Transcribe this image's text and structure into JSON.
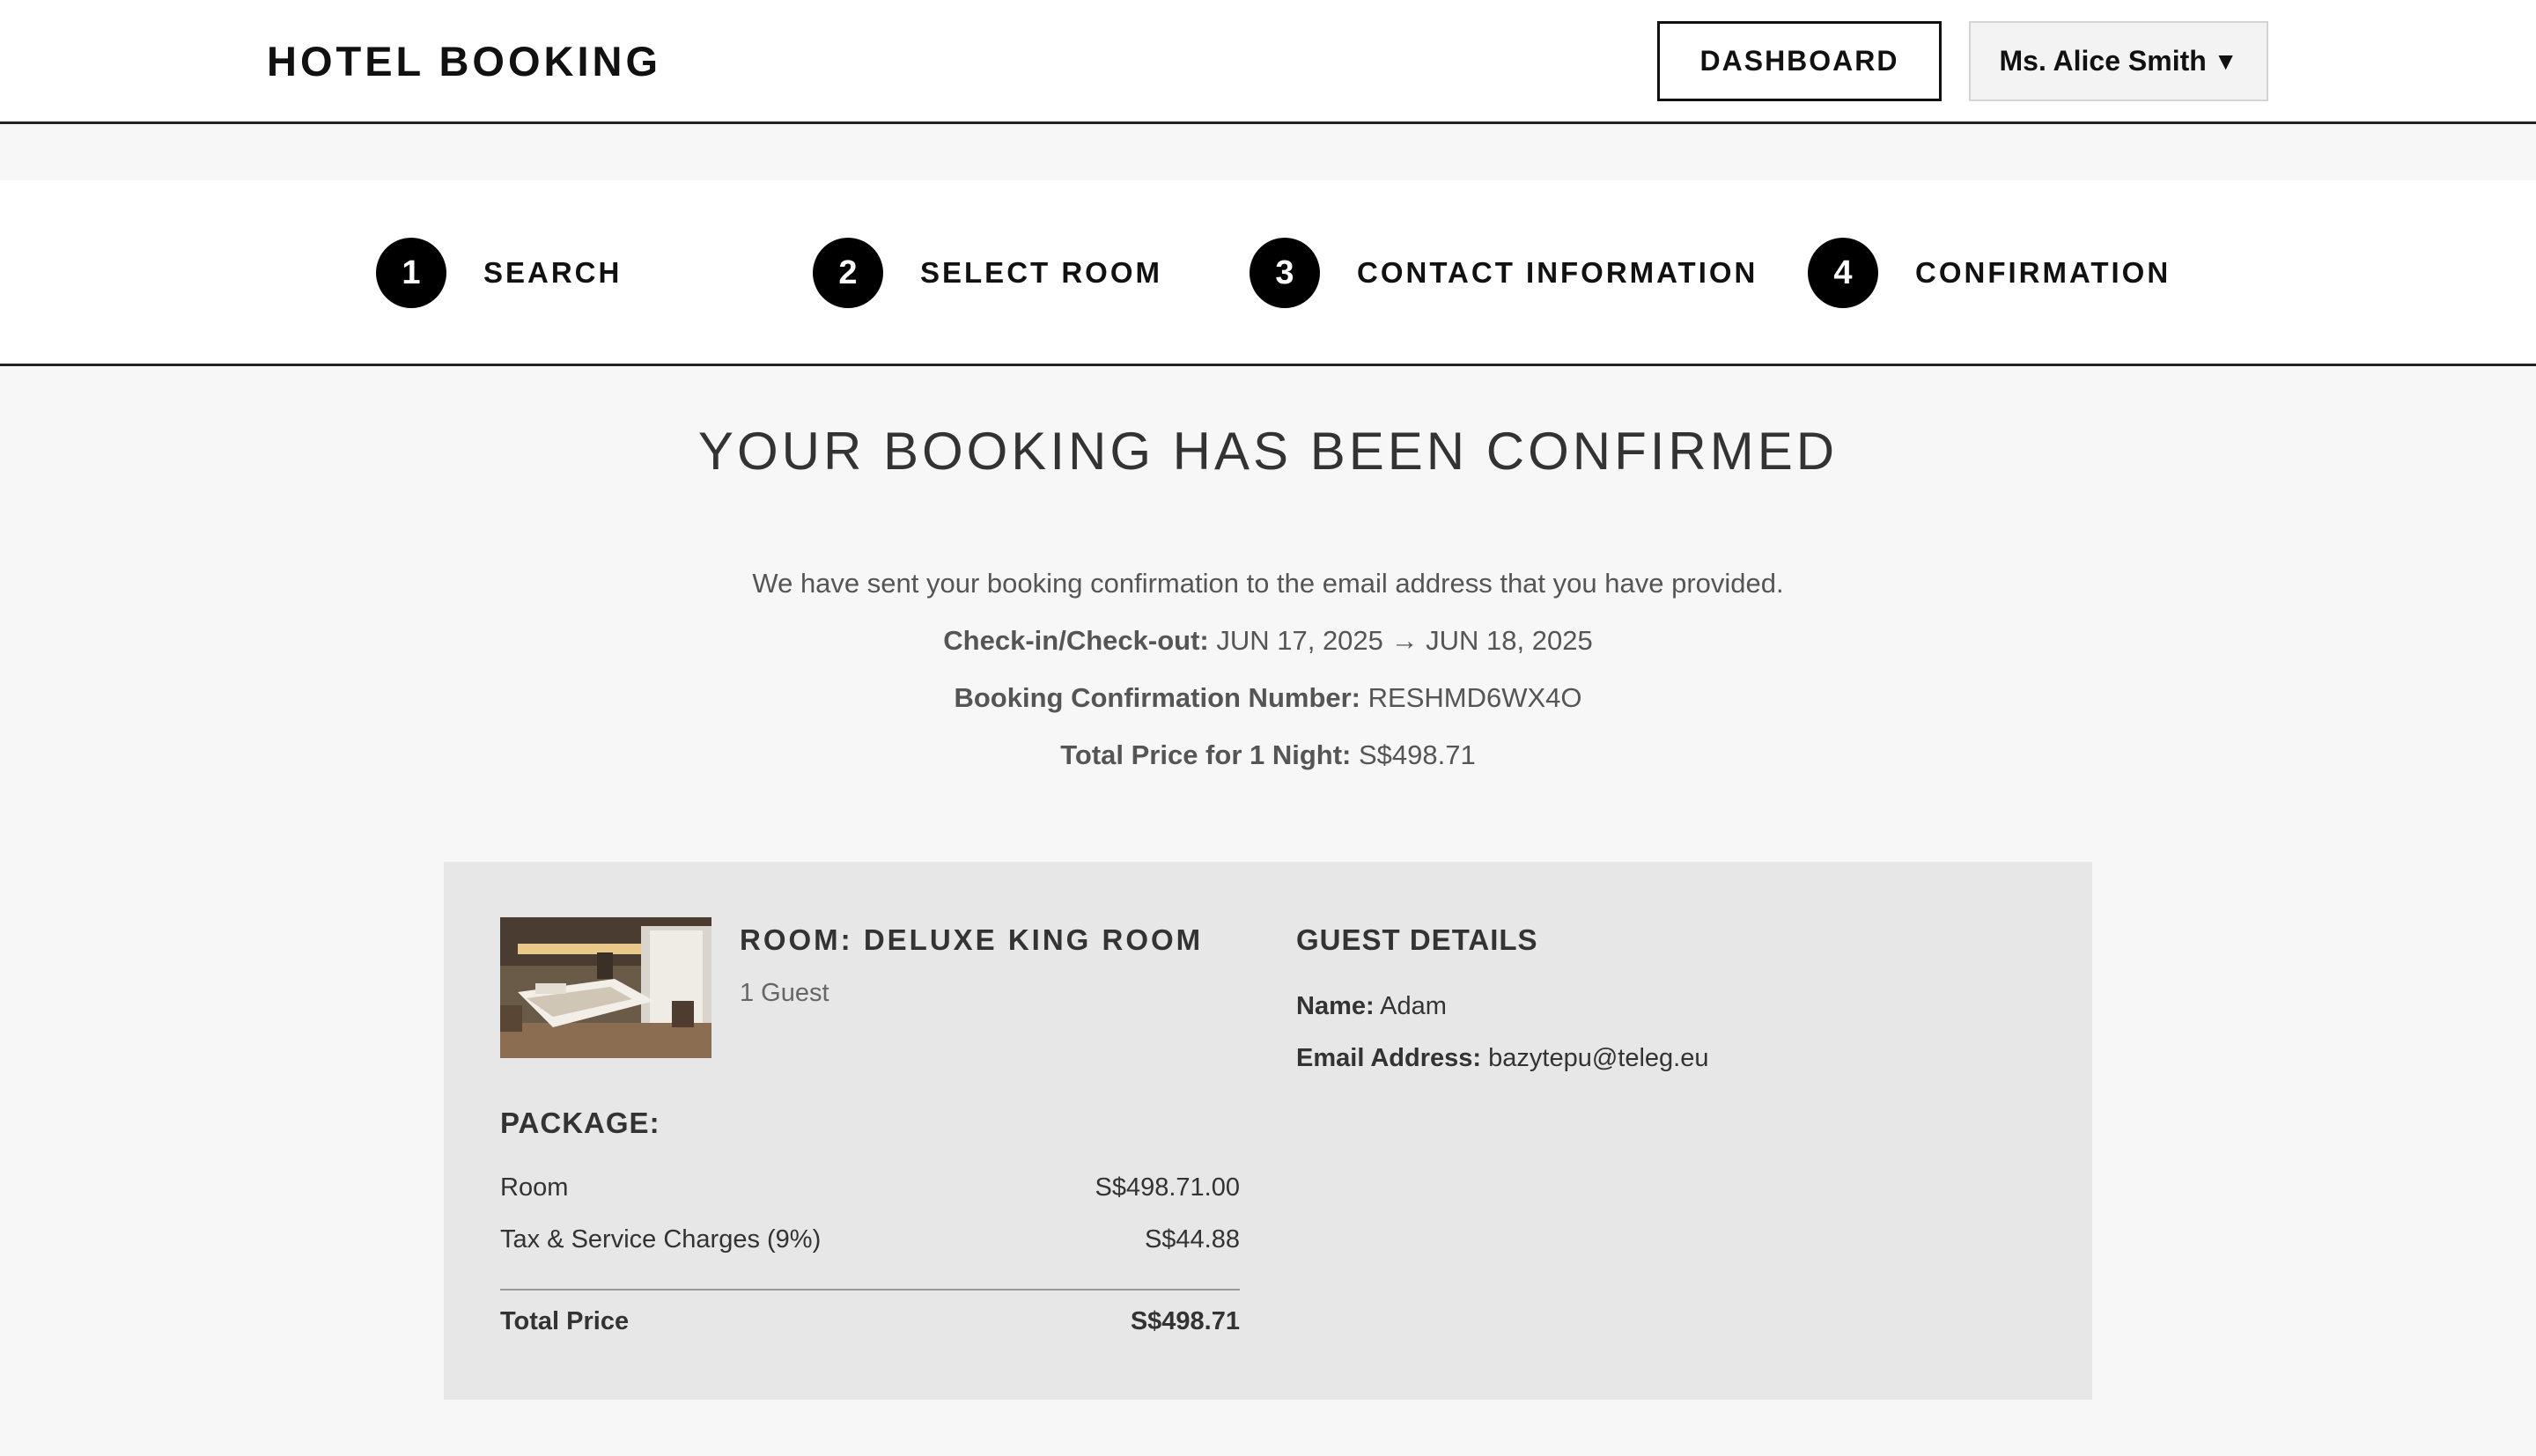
{
  "header": {
    "brand": "HOTEL BOOKING",
    "dashboard_label": "DASHBOARD",
    "user_label": "Ms. Alice Smith",
    "user_caret": "▼"
  },
  "steps": [
    {
      "number": "1",
      "label": "SEARCH"
    },
    {
      "number": "2",
      "label": "SELECT ROOM"
    },
    {
      "number": "3",
      "label": "CONTACT INFORMATION"
    },
    {
      "number": "4",
      "label": "CONFIRMATION"
    }
  ],
  "confirmation": {
    "title": "YOUR BOOKING HAS BEEN CONFIRMED",
    "message": "We have sent your booking confirmation to the email address that you have provided.",
    "checkin_label": "Check-in/Check-out:",
    "checkin_value": "JUN 17, 2025 → JUN 18, 2025",
    "number_label": "Booking Confirmation Number:",
    "number_value": "RESHMD6WX4O",
    "total_label": "Total Price for 1 Night:",
    "total_value": "S$498.71"
  },
  "room": {
    "title": "ROOM: DELUXE KING ROOM",
    "guests": "1 Guest"
  },
  "guest": {
    "heading": "GUEST DETAILS",
    "name_label": "Name:",
    "name_value": "Adam",
    "email_label": "Email Address:",
    "email_value": "bazytepu@teleg.eu"
  },
  "package": {
    "heading": "PACKAGE:",
    "rows": [
      {
        "label": "Room",
        "value": "S$498.71.00"
      },
      {
        "label": "Tax & Service Charges (9%)",
        "value": "S$44.88"
      }
    ],
    "total_label": "Total Price",
    "total_value": "S$498.71"
  }
}
